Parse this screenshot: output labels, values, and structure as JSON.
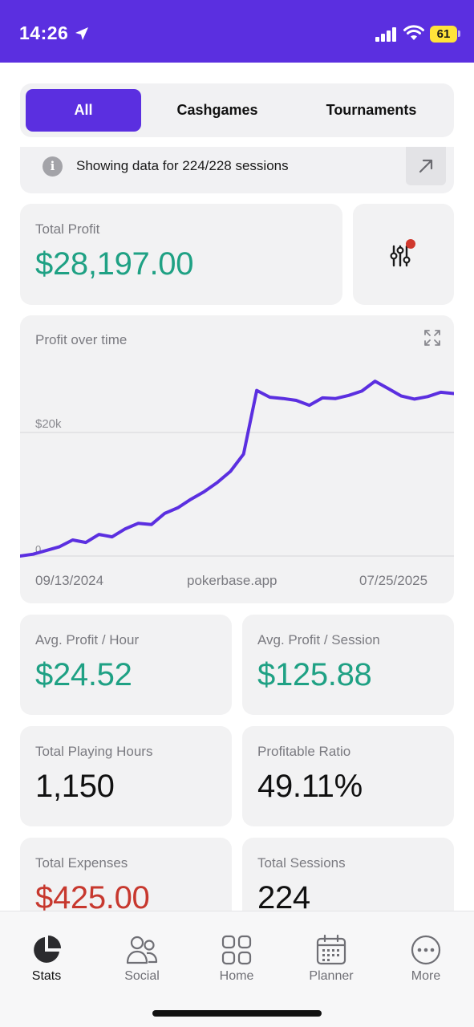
{
  "status_bar": {
    "time": "14:26",
    "battery": "61"
  },
  "filter_tabs": [
    {
      "label": "All",
      "active": true
    },
    {
      "label": "Cashgames",
      "active": false
    },
    {
      "label": "Tournaments",
      "active": false
    }
  ],
  "info_banner": {
    "icon": "i",
    "text": "Showing data for 224/228 sessions"
  },
  "total_profit": {
    "label": "Total Profit",
    "value": "$28,197.00"
  },
  "profit_chart": {
    "title": "Profit over time",
    "start_date": "09/13/2024",
    "watermark": "pokerbase.app",
    "end_date": "07/25/2025",
    "gridline_label": "$20k",
    "baseline_label": "0"
  },
  "chart_data": {
    "type": "line",
    "title": "Profit over time",
    "x_range": [
      "09/13/2024",
      "07/25/2025"
    ],
    "series": [
      {
        "values": [
          0,
          300,
          900,
          1500,
          2600,
          2200,
          3500,
          3100,
          4400,
          5300,
          5100,
          6900,
          7800,
          9200,
          10400,
          11900,
          13700,
          16500,
          26800,
          25700,
          25500,
          25200,
          24400,
          25600,
          25500,
          26000,
          26700,
          28300,
          27100,
          25900,
          25400,
          25800,
          26500,
          26300
        ]
      }
    ],
    "gridlines": [
      20000
    ],
    "line_color": "#5b2fe0"
  },
  "stat_cards": [
    {
      "label": "Avg. Profit / Hour",
      "value": "$24.52",
      "tone": "green"
    },
    {
      "label": "Avg. Profit / Session",
      "value": "$125.88",
      "tone": "green"
    },
    {
      "label": "Total Playing Hours",
      "value": "1,150",
      "tone": "default"
    },
    {
      "label": "Profitable Ratio",
      "value": "49.11%",
      "tone": "default"
    },
    {
      "label": "Total Expenses",
      "value": "$425.00",
      "tone": "red"
    },
    {
      "label": "Total Sessions",
      "value": "224",
      "tone": "default"
    }
  ],
  "tab_bar": [
    {
      "label": "Stats",
      "icon": "pie-chart-icon",
      "active": true
    },
    {
      "label": "Social",
      "icon": "people-icon",
      "active": false
    },
    {
      "label": "Home",
      "icon": "grid-icon",
      "active": false
    },
    {
      "label": "Planner",
      "icon": "calendar-icon",
      "active": false
    },
    {
      "label": "More",
      "icon": "ellipsis-circle-icon",
      "active": false
    }
  ],
  "colors": {
    "brand": "#5b2fe0",
    "profit_green": "#1fa184",
    "expense_red": "#c7382e",
    "card_bg": "#f2f2f3"
  }
}
